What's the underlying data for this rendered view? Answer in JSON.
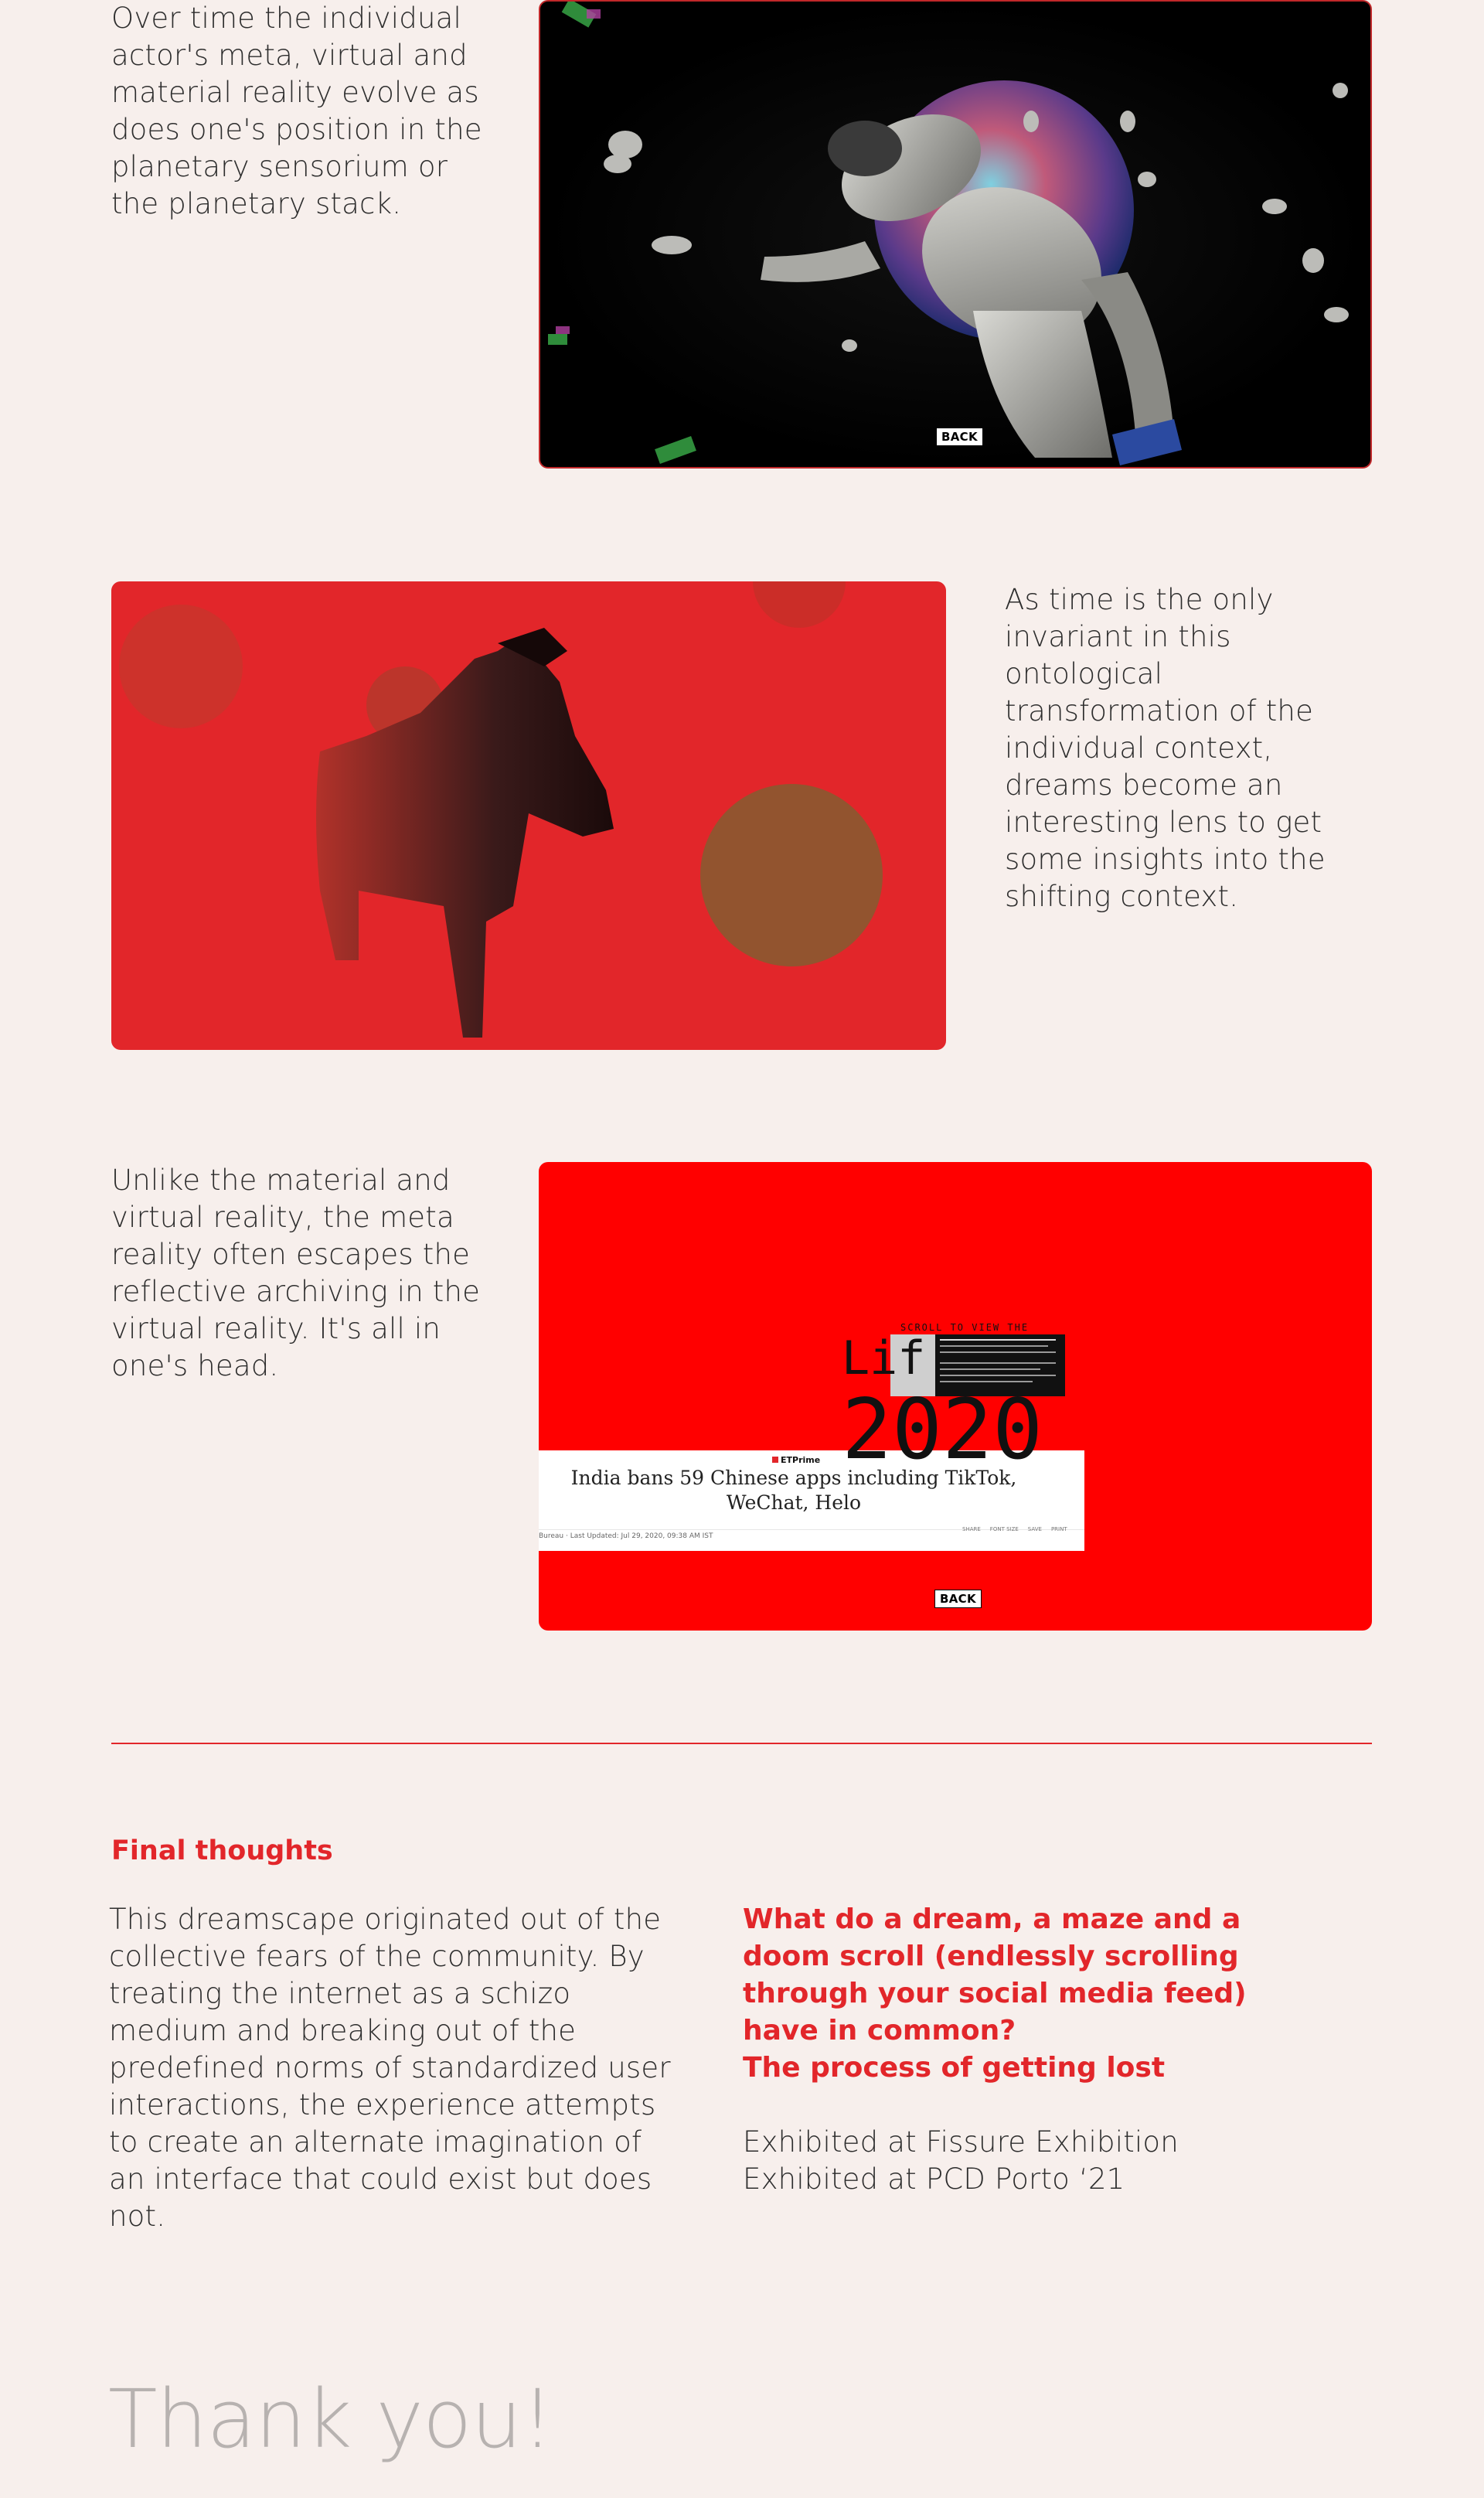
{
  "section1": {
    "text": "Over time the individual actor's meta, virtual and material reality evolve as does one's position in the planetary sensorium or the planetary stack.",
    "back_label": "BACK"
  },
  "section2": {
    "text": "As time is the only invariant in this ontological transformation of the individual context, dreams become an interesting lens to get some insights into the shifting context."
  },
  "section3": {
    "text": "Unlike the material and virtual reality, the meta reality often escapes the reflective archiving in the virtual reality. It's all in one's head.",
    "overlay_small": "SCROLL TO VIEW THE",
    "overlay_lif": "Lif",
    "overlay_year": "2020",
    "news_brand": "ETPrime",
    "news_headline": "India bans 59 Chinese apps including TikTok, WeChat, Helo",
    "news_meta": "Bureau  ·  Last Updated: Jul 29, 2020, 09:38 AM IST",
    "news_actions": [
      "SHARE",
      "FONT SIZE",
      "SAVE",
      "PRINT"
    ],
    "back_label": "BACK"
  },
  "final": {
    "heading": "Final thoughts",
    "paragraph": "This dreamscape originated out of the collective fears of the community. By treating the internet as a schizo medium and breaking out of the predefined norms of standardized user interactions, the experience attempts to create an alternate imagination of an interface that could exist but does not.",
    "question": "What do a dream, a maze and a doom scroll (endlessly scrolling through your social media feed) have in common?",
    "answer": "The process of getting lost",
    "exhibit1": "Exhibited at Fissure Exhibition",
    "exhibit2": "Exhibited at PCD Porto ‘21"
  },
  "footer": {
    "thanks": "Thank you!"
  },
  "colors": {
    "background": "#f7efec",
    "accent": "#e2262a",
    "text": "#2d2d2d",
    "muted": "#b7b2b0"
  }
}
